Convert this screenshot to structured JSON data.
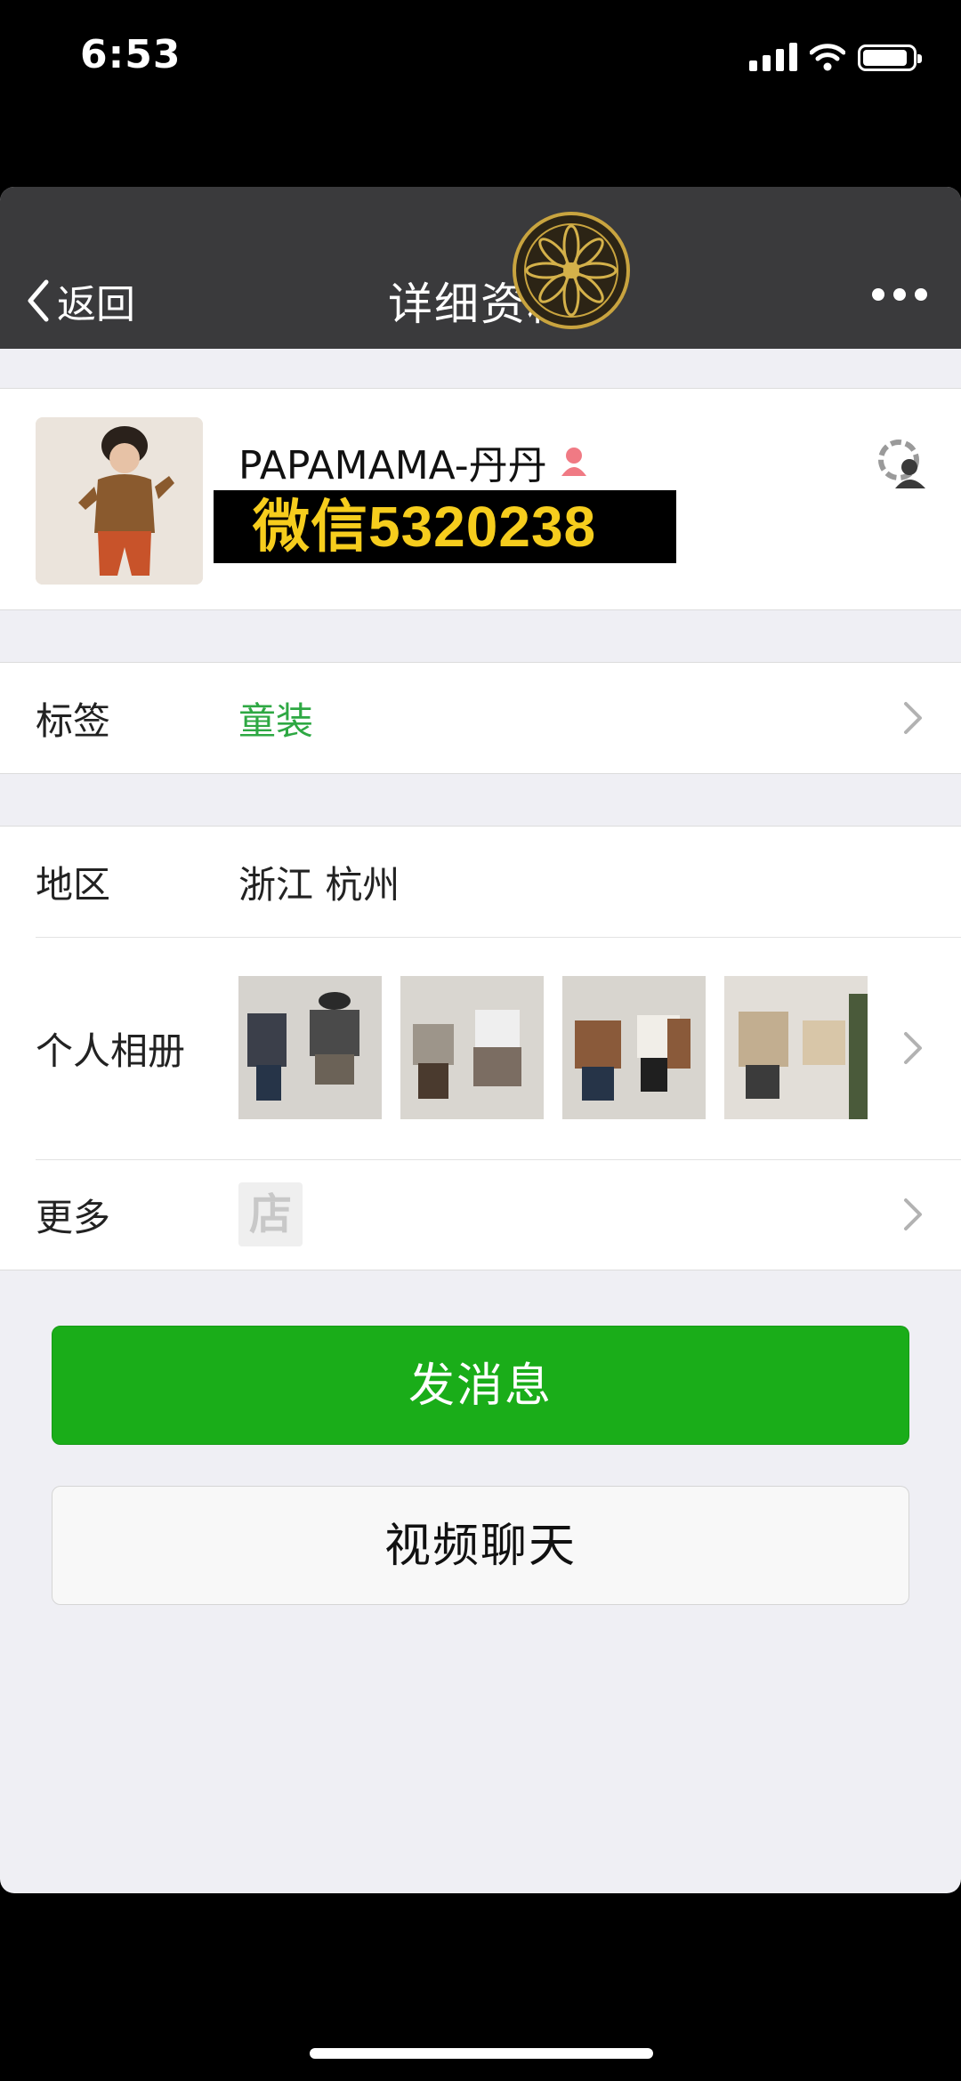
{
  "status_bar": {
    "time": "6:53",
    "icons": [
      "signal-icon",
      "wifi-icon",
      "battery-icon"
    ],
    "battery_level": 0.9
  },
  "navbar": {
    "back_label": "返回",
    "title": "详细资料",
    "more_icon": "more-dots-icon"
  },
  "profile": {
    "nickname": "PAPAMAMA-丹丹",
    "gender_icon": "female-icon",
    "banner_text": "微信5320238",
    "moments_icon": "moments-icon"
  },
  "rows": {
    "tag": {
      "label": "标签",
      "value": "童装"
    },
    "region": {
      "label": "地区",
      "value": "浙江  杭州"
    },
    "album": {
      "label": "个人相册"
    },
    "more": {
      "label": "更多",
      "shop_glyph": "店"
    }
  },
  "buttons": {
    "message": "发消息",
    "video_call": "视频聊天"
  },
  "colors": {
    "accent_green": "#1aad19",
    "tag_green": "#2ea843",
    "navbar": "#3a3a3c",
    "banner_text": "#f6cd1d"
  }
}
